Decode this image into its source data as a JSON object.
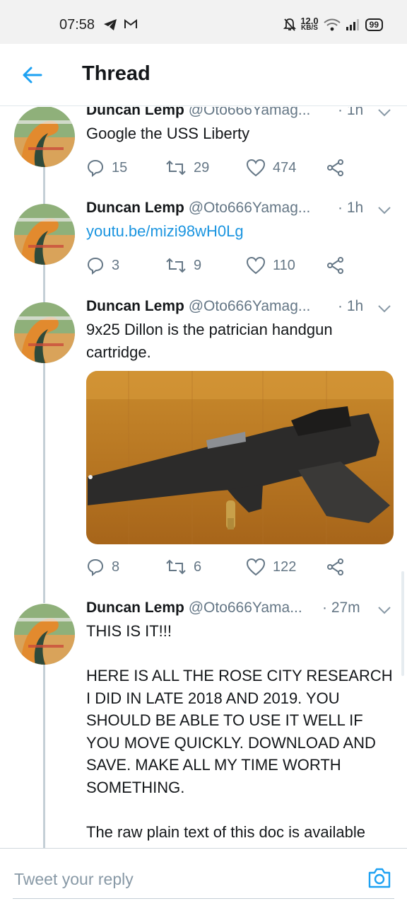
{
  "status_bar": {
    "time": "07:58",
    "net_speed": "12.0",
    "net_unit": "KB/S",
    "battery": "99",
    "icons": [
      "telegram-icon",
      "gmail-icon",
      "mute-icon",
      "wifi-icon",
      "signal-icon",
      "battery-icon"
    ]
  },
  "header": {
    "title": "Thread",
    "back_icon": "arrow-left-icon",
    "accent_color": "#1da1f2"
  },
  "tweets": [
    {
      "author": "Duncan Lemp",
      "handle": "@Oto666Yamag...",
      "time": "· 1h",
      "text": "Google the USS Liberty",
      "replies": "15",
      "retweets": "29",
      "likes": "474"
    },
    {
      "author": "Duncan Lemp",
      "handle": "@Oto666Yamag...",
      "time": "· 1h",
      "link": "youtu.be/mizi98wH0Lg",
      "replies": "3",
      "retweets": "9",
      "likes": "110"
    },
    {
      "author": "Duncan Lemp",
      "handle": "@Oto666Yamag...",
      "time": "· 1h",
      "text": "9x25 Dillon is the patrician handgun cartridge.",
      "media": "photo of handgun with red-dot sight and cartridge on wooden floor",
      "replies": "8",
      "retweets": "6",
      "likes": "122"
    },
    {
      "author": "Duncan Lemp",
      "handle": "@Oto666Yama...",
      "time": "· 27m",
      "text_lines": [
        "THIS IS IT!!!",
        "HERE IS ALL THE ROSE CITY RESEARCH I DID IN LATE 2018 AND 2019. YOU SHOULD BE ABLE TO USE IT WELL IF YOU MOVE QUICKLY. DOWNLOAD AND SAVE. MAKE ALL MY TIME WORTH SOMETHING.",
        "The raw plain text of this doc is available"
      ]
    }
  ],
  "reply_bar": {
    "placeholder": "Tweet your reply",
    "camera_icon": "camera-icon"
  }
}
